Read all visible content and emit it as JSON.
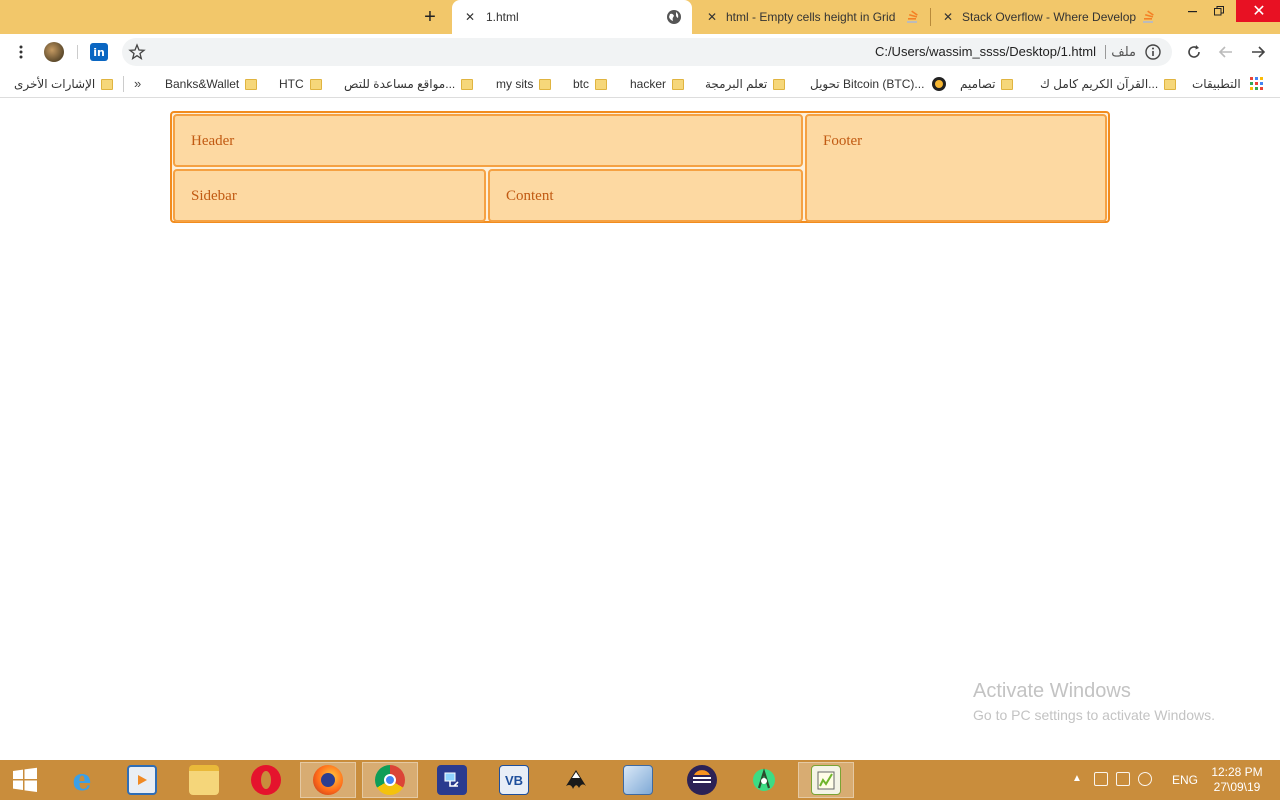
{
  "browser": {
    "tabs": [
      {
        "title": "1.html",
        "active": true,
        "icon": "globe-icon"
      },
      {
        "title": "html - Empty cells height in Grid",
        "active": false,
        "icon": "stackoverflow-icon"
      },
      {
        "title": "Stack Overflow - Where Develop",
        "active": false,
        "icon": "stackoverflow-icon"
      }
    ],
    "omnibox": {
      "url": "C:/Users/wassim_ssss/Desktop/1.html",
      "scheme_label": "ملف"
    },
    "bookmarks": [
      {
        "label": "التطبيقات",
        "icon": "apps-icon"
      },
      {
        "label": "القرآن الكريم كامل ك...",
        "icon": "folder-icon"
      },
      {
        "label": "تصاميم",
        "icon": "folder-icon"
      },
      {
        "label": "تحويل Bitcoin (BTC)...",
        "icon": "site-icon"
      },
      {
        "label": "تعلم البرمجة",
        "icon": "folder-icon"
      },
      {
        "label": "hacker",
        "icon": "folder-icon"
      },
      {
        "label": "btc",
        "icon": "folder-icon"
      },
      {
        "label": "my sits",
        "icon": "folder-icon"
      },
      {
        "label": "مواقع مساعدة للتص...",
        "icon": "folder-icon"
      },
      {
        "label": "HTC",
        "icon": "folder-icon"
      },
      {
        "label": "Banks&Wallet",
        "icon": "folder-icon"
      },
      {
        "label": "»",
        "icon": "chevron-icon"
      },
      {
        "label": "الإشارات الأخرى",
        "icon": "folder-icon"
      }
    ]
  },
  "page": {
    "grid": {
      "header": "Header",
      "footer": "Footer",
      "sidebar": "Sidebar",
      "content": "Content"
    }
  },
  "watermark": {
    "title": "Activate Windows",
    "subtitle": "Go to PC settings to activate Windows."
  },
  "taskbar": {
    "apps": [
      "internet-explorer",
      "media-player",
      "file-explorer",
      "opera",
      "firefox",
      "chrome",
      "network-tool",
      "visual-basic",
      "inkscape",
      "virtualbox",
      "eclipse",
      "android-studio",
      "notepad-plus-plus"
    ],
    "language": "ENG",
    "time": "12:28 PM",
    "date": "27\\09\\19"
  },
  "colors": {
    "tabstrip": "#f2c76a",
    "grid_border": "#f28c1e",
    "cell_bg": "#fdd9a2",
    "cell_text": "#c15a12",
    "taskbar": "#c98d3c"
  }
}
